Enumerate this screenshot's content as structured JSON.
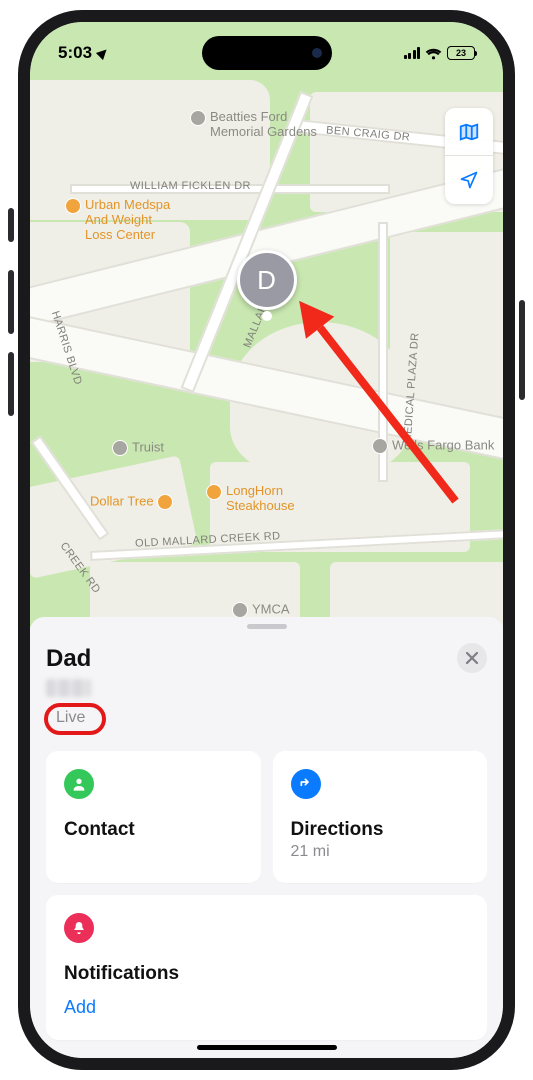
{
  "status": {
    "time": "5:03",
    "battery": "23"
  },
  "map": {
    "avatar_initial": "D",
    "labels": {
      "ben_craig": "Ben Craig Dr",
      "ficklen": "William Ficklen Dr",
      "harris": "Harris Blvd",
      "mallard": "Mallard",
      "medical": "Medical Plaza Dr",
      "old_mallard": "Old Mallard Creek Rd",
      "creek": "Creek Rd"
    },
    "poi": {
      "beatties": "Beatties Ford\nMemorial Gardens",
      "urban": "Urban Medspa\nAnd Weight\nLoss Center",
      "longhorn": "LongHorn\nSteakhouse",
      "dollar": "Dollar Tree",
      "truist": "Truist",
      "wells": "Wells Fargo Bank",
      "ymca": "YMCA"
    }
  },
  "sheet": {
    "title": "Dad",
    "live": "Live",
    "contact_label": "Contact",
    "directions_label": "Directions",
    "directions_sub": "21 mi",
    "notifications_label": "Notifications",
    "add_label": "Add"
  }
}
